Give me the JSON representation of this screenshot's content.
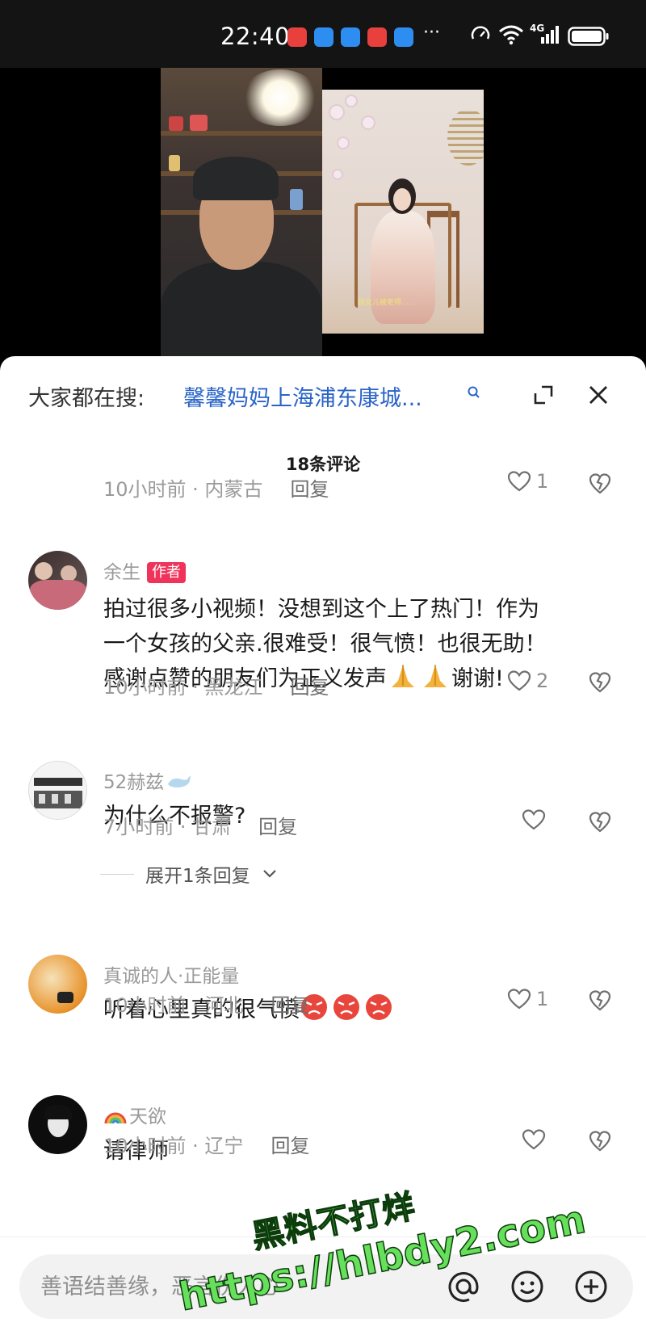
{
  "status_bar": {
    "time": "22:40",
    "more": "···",
    "network": "4G",
    "notification_icons": [
      "app-red-icon",
      "message-blue-icon",
      "shield-blue-icon",
      "app-red-icon",
      "browser-blue-icon"
    ],
    "colors": {
      "red": "#e8403c",
      "blue": "#2e8df0"
    }
  },
  "video": {
    "caption": "我女儿被老师……"
  },
  "search": {
    "prefix": "大家都在搜:",
    "term": "馨馨妈妈上海浦东康城..."
  },
  "comments_header": {
    "count_label": "18条评论"
  },
  "comments": [
    {
      "time_location": "10小时前 · 内蒙古",
      "reply_label": "回复",
      "likes": "1"
    },
    {
      "name": "余生",
      "badge": "作者",
      "text_line1": "拍过很多小视频！没想到这个上了热门！作为",
      "text_line2": "一个女孩的父亲.很难受！很气愤！也很无助！",
      "text_line3": "感谢点赞的朋友们为正义发声",
      "text_tail": "谢谢!",
      "time_location": "10小时前 · 黑龙江",
      "reply_label": "回复",
      "likes": "2"
    },
    {
      "name": "52赫兹",
      "text": "为什么不报警?",
      "time_location": "7小时前 · 甘肃",
      "reply_label": "回复",
      "likes": "",
      "expand_label": "展开1条回复"
    },
    {
      "name": "真诚的人·正能量",
      "text": "听着心里真的很气愤",
      "time_location": "10小时前 · 河北",
      "reply_label": "回复",
      "likes": "1"
    },
    {
      "name": "天欲",
      "text": "请律师",
      "time_location": "10小时前 · 辽宁",
      "reply_label": "回复",
      "likes": ""
    }
  ],
  "input": {
    "placeholder": "善语结善缘，恶言伤人心"
  },
  "watermark": {
    "line1": "黑料不打烊",
    "line2": "https://hlbdy2.com"
  },
  "theme": {
    "link_blue": "#2a64c8",
    "author_badge": "#f0335a",
    "watermark_green": "#66e05a"
  }
}
